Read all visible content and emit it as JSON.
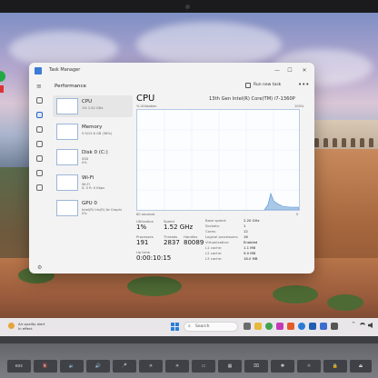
{
  "task_manager": {
    "window_title": "Task Manager",
    "section_title": "Performance",
    "run_new_task_label": "Run new task",
    "more_label": "•••",
    "window_controls": {
      "minimize": "—",
      "maximize": "☐",
      "close": "✕"
    },
    "perf_list": [
      {
        "name": "CPU",
        "sub": "1% 1.52 GHz"
      },
      {
        "name": "Memory",
        "sub": "5.9/15.6 GB (38%)"
      },
      {
        "name": "Disk 0 (C:)",
        "sub": "SSD\n0%"
      },
      {
        "name": "Wi-Fi",
        "sub": "Wi-Fi\nS: 0 R: 0 Kbps"
      },
      {
        "name": "GPU 0",
        "sub": "Intel(R) Iris(R) Xe Graphi\n0%"
      }
    ],
    "detail": {
      "title": "CPU",
      "model": "13th Gen Intel(R) Core(TM) i7-1360P",
      "axis_top_left": "% Utilization",
      "axis_top_right": "100%",
      "axis_bottom_left": "60 seconds",
      "axis_bottom_right": "0",
      "utilization_label": "Utilization",
      "utilization_value": "1%",
      "speed_label": "Speed",
      "speed_value": "1.52 GHz",
      "processes_label": "Processes",
      "processes_value": "191",
      "threads_label": "Threads",
      "threads_value": "2837",
      "handles_label": "Handles",
      "handles_value": "80089",
      "uptime_label": "Up time",
      "uptime_value": "0:00:10:15",
      "kv": [
        {
          "label": "Base speed:",
          "value": "2.20 GHz"
        },
        {
          "label": "Sockets:",
          "value": "1"
        },
        {
          "label": "Cores:",
          "value": "12"
        },
        {
          "label": "Logical processors:",
          "value": "16"
        },
        {
          "label": "Virtualization:",
          "value": "Enabled"
        },
        {
          "label": "L1 cache:",
          "value": "1.1 MB"
        },
        {
          "label": "L2 cache:",
          "value": "9.0 MB"
        },
        {
          "label": "L3 cache:",
          "value": "18.0 MB"
        }
      ]
    }
  },
  "taskbar": {
    "air_quality_line1": "Air quality alert",
    "air_quality_line2": "In effect",
    "search_placeholder": "Search"
  },
  "keyboard": {
    "function_keys": [
      "esc",
      "🔇",
      "🔉",
      "🔊",
      "🎤",
      "☀",
      "☀",
      "▭",
      "▦",
      "⌧",
      "✱",
      "☼",
      "🔒",
      "⏏"
    ]
  }
}
